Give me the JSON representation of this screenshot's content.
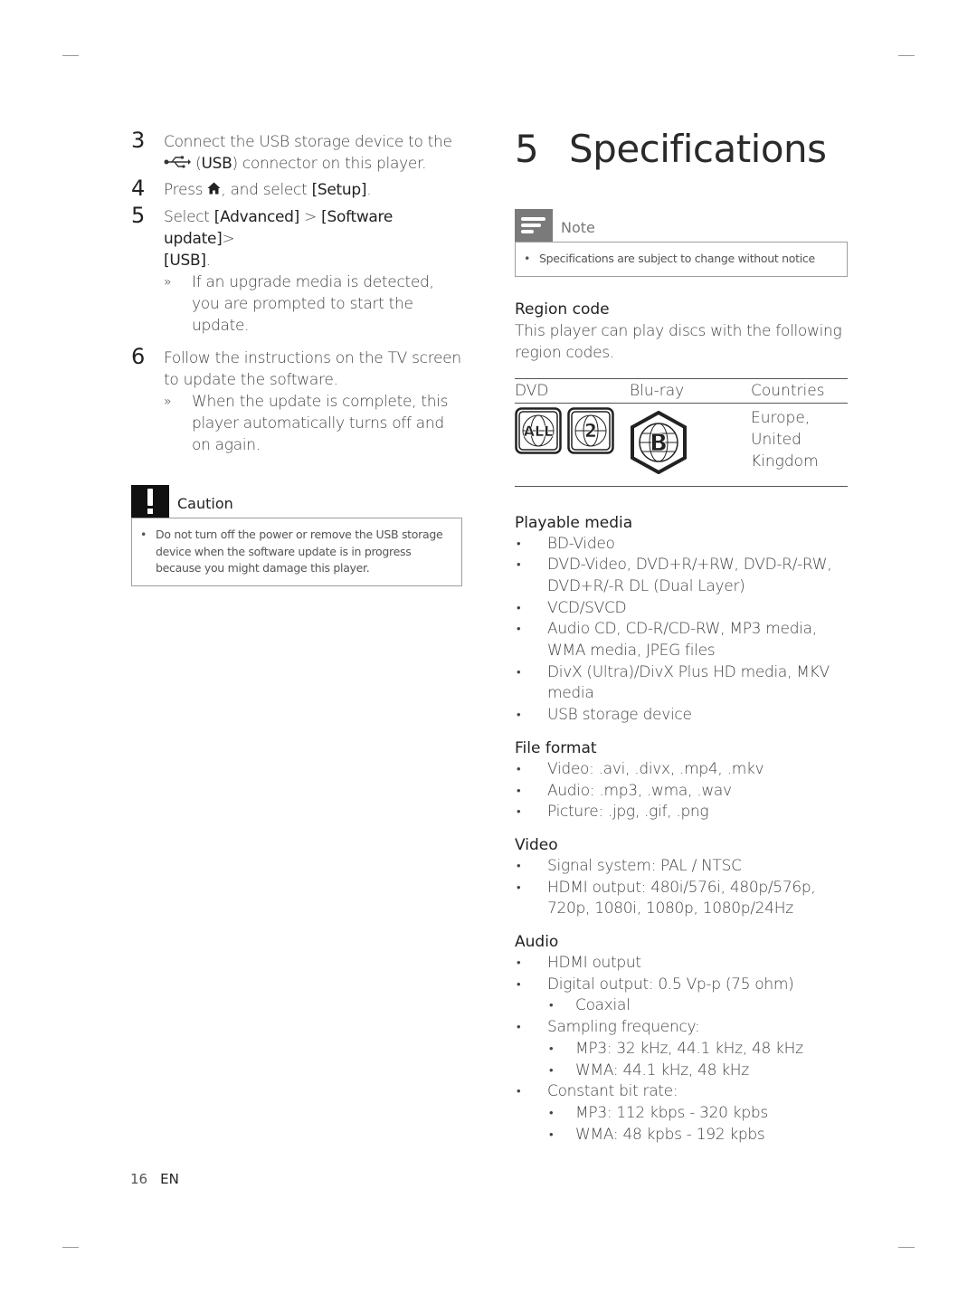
{
  "left_column": {
    "steps": [
      {
        "num": "3",
        "line1": "Connect the USB storage device to the",
        "line2_bold": "USB",
        "line2_suffix": " connector on this player.",
        "icon": "usb-icon"
      },
      {
        "num": "4",
        "prefix": "Press ",
        "icon": "home-icon",
        "middle": ", and select ",
        "bold": "[Setup]",
        "suffix": "."
      },
      {
        "num": "5",
        "prefix": "Select ",
        "bold1": "[Advanced]",
        "sep": " > ",
        "bold2": "[Software update]",
        "sep2": ">",
        "bold3": "[USB]",
        "suffix": ".",
        "result_marker": "»",
        "result": "If an upgrade media is detected, you are prompted to start the update."
      },
      {
        "num": "6",
        "text": "Follow the instructions on the TV screen to update the software.",
        "result_marker": "»",
        "result": "When the update is complete, this player automatically turns off and on again."
      }
    ],
    "caution": {
      "icon": "exclamation-icon",
      "label": "Caution",
      "items": [
        "Do not turn off the power or remove the USB storage device when the software update is in progress because you might damage this player."
      ]
    }
  },
  "right_column": {
    "chapter_number": "5",
    "chapter_title": "Specifications",
    "note": {
      "icon": "note-lines-icon",
      "label": "Note",
      "items": [
        "Specifications are subject to change without notice"
      ]
    },
    "region_code": {
      "heading": "Region code",
      "description": "This player can play discs with the following region codes.",
      "table": {
        "headers": [
          "DVD",
          "Blu-ray",
          "Countries"
        ],
        "rows": [
          {
            "dvd_icons": [
              "dvd-region-all-icon",
              "dvd-region-2-icon"
            ],
            "dvd_labels": [
              "ALL",
              "2"
            ],
            "bluray_icon": "bluray-region-b-icon",
            "bluray_label": "B",
            "countries": "Europe, United Kingdom"
          }
        ]
      }
    },
    "sections": [
      {
        "heading": "Playable media",
        "items": [
          {
            "level": 1,
            "text": "BD-Video"
          },
          {
            "level": 1,
            "text": "DVD-Video, DVD+R/+RW, DVD-R/-RW, DVD+R/-R DL (Dual Layer)"
          },
          {
            "level": 1,
            "text": "VCD/SVCD"
          },
          {
            "level": 1,
            "text": "Audio CD, CD-R/CD-RW, MP3 media, WMA media, JPEG files"
          },
          {
            "level": 1,
            "text": "DivX (Ultra)/DivX Plus HD media, MKV media"
          },
          {
            "level": 1,
            "text": "USB storage device"
          }
        ]
      },
      {
        "heading": "File format",
        "items": [
          {
            "level": 1,
            "text": "Video: .avi, .divx, .mp4, .mkv"
          },
          {
            "level": 1,
            "text": "Audio: .mp3, .wma, .wav"
          },
          {
            "level": 1,
            "text": "Picture: .jpg, .gif, .png"
          }
        ]
      },
      {
        "heading": "Video",
        "items": [
          {
            "level": 1,
            "text": "Signal system: PAL / NTSC"
          },
          {
            "level": 1,
            "text": "HDMI output: 480i/576i, 480p/576p, 720p, 1080i, 1080p, 1080p/24Hz"
          }
        ]
      },
      {
        "heading": "Audio",
        "items": [
          {
            "level": 1,
            "text": "HDMI output"
          },
          {
            "level": 1,
            "text": "Digital output: 0.5 Vp-p (75 ohm)"
          },
          {
            "level": 2,
            "text": "Coaxial"
          },
          {
            "level": 1,
            "text": "Sampling frequency:"
          },
          {
            "level": 2,
            "text": "MP3: 32 kHz, 44.1 kHz, 48 kHz"
          },
          {
            "level": 2,
            "text": "WMA: 44.1 kHz, 48 kHz"
          },
          {
            "level": 1,
            "text": "Constant bit rate:"
          },
          {
            "level": 2,
            "text": "MP3: 112 kbps - 320 kpbs"
          },
          {
            "level": 2,
            "text": "WMA: 48 kpbs - 192 kpbs"
          }
        ]
      }
    ]
  },
  "footer": {
    "page_number": "16",
    "language": "EN"
  }
}
